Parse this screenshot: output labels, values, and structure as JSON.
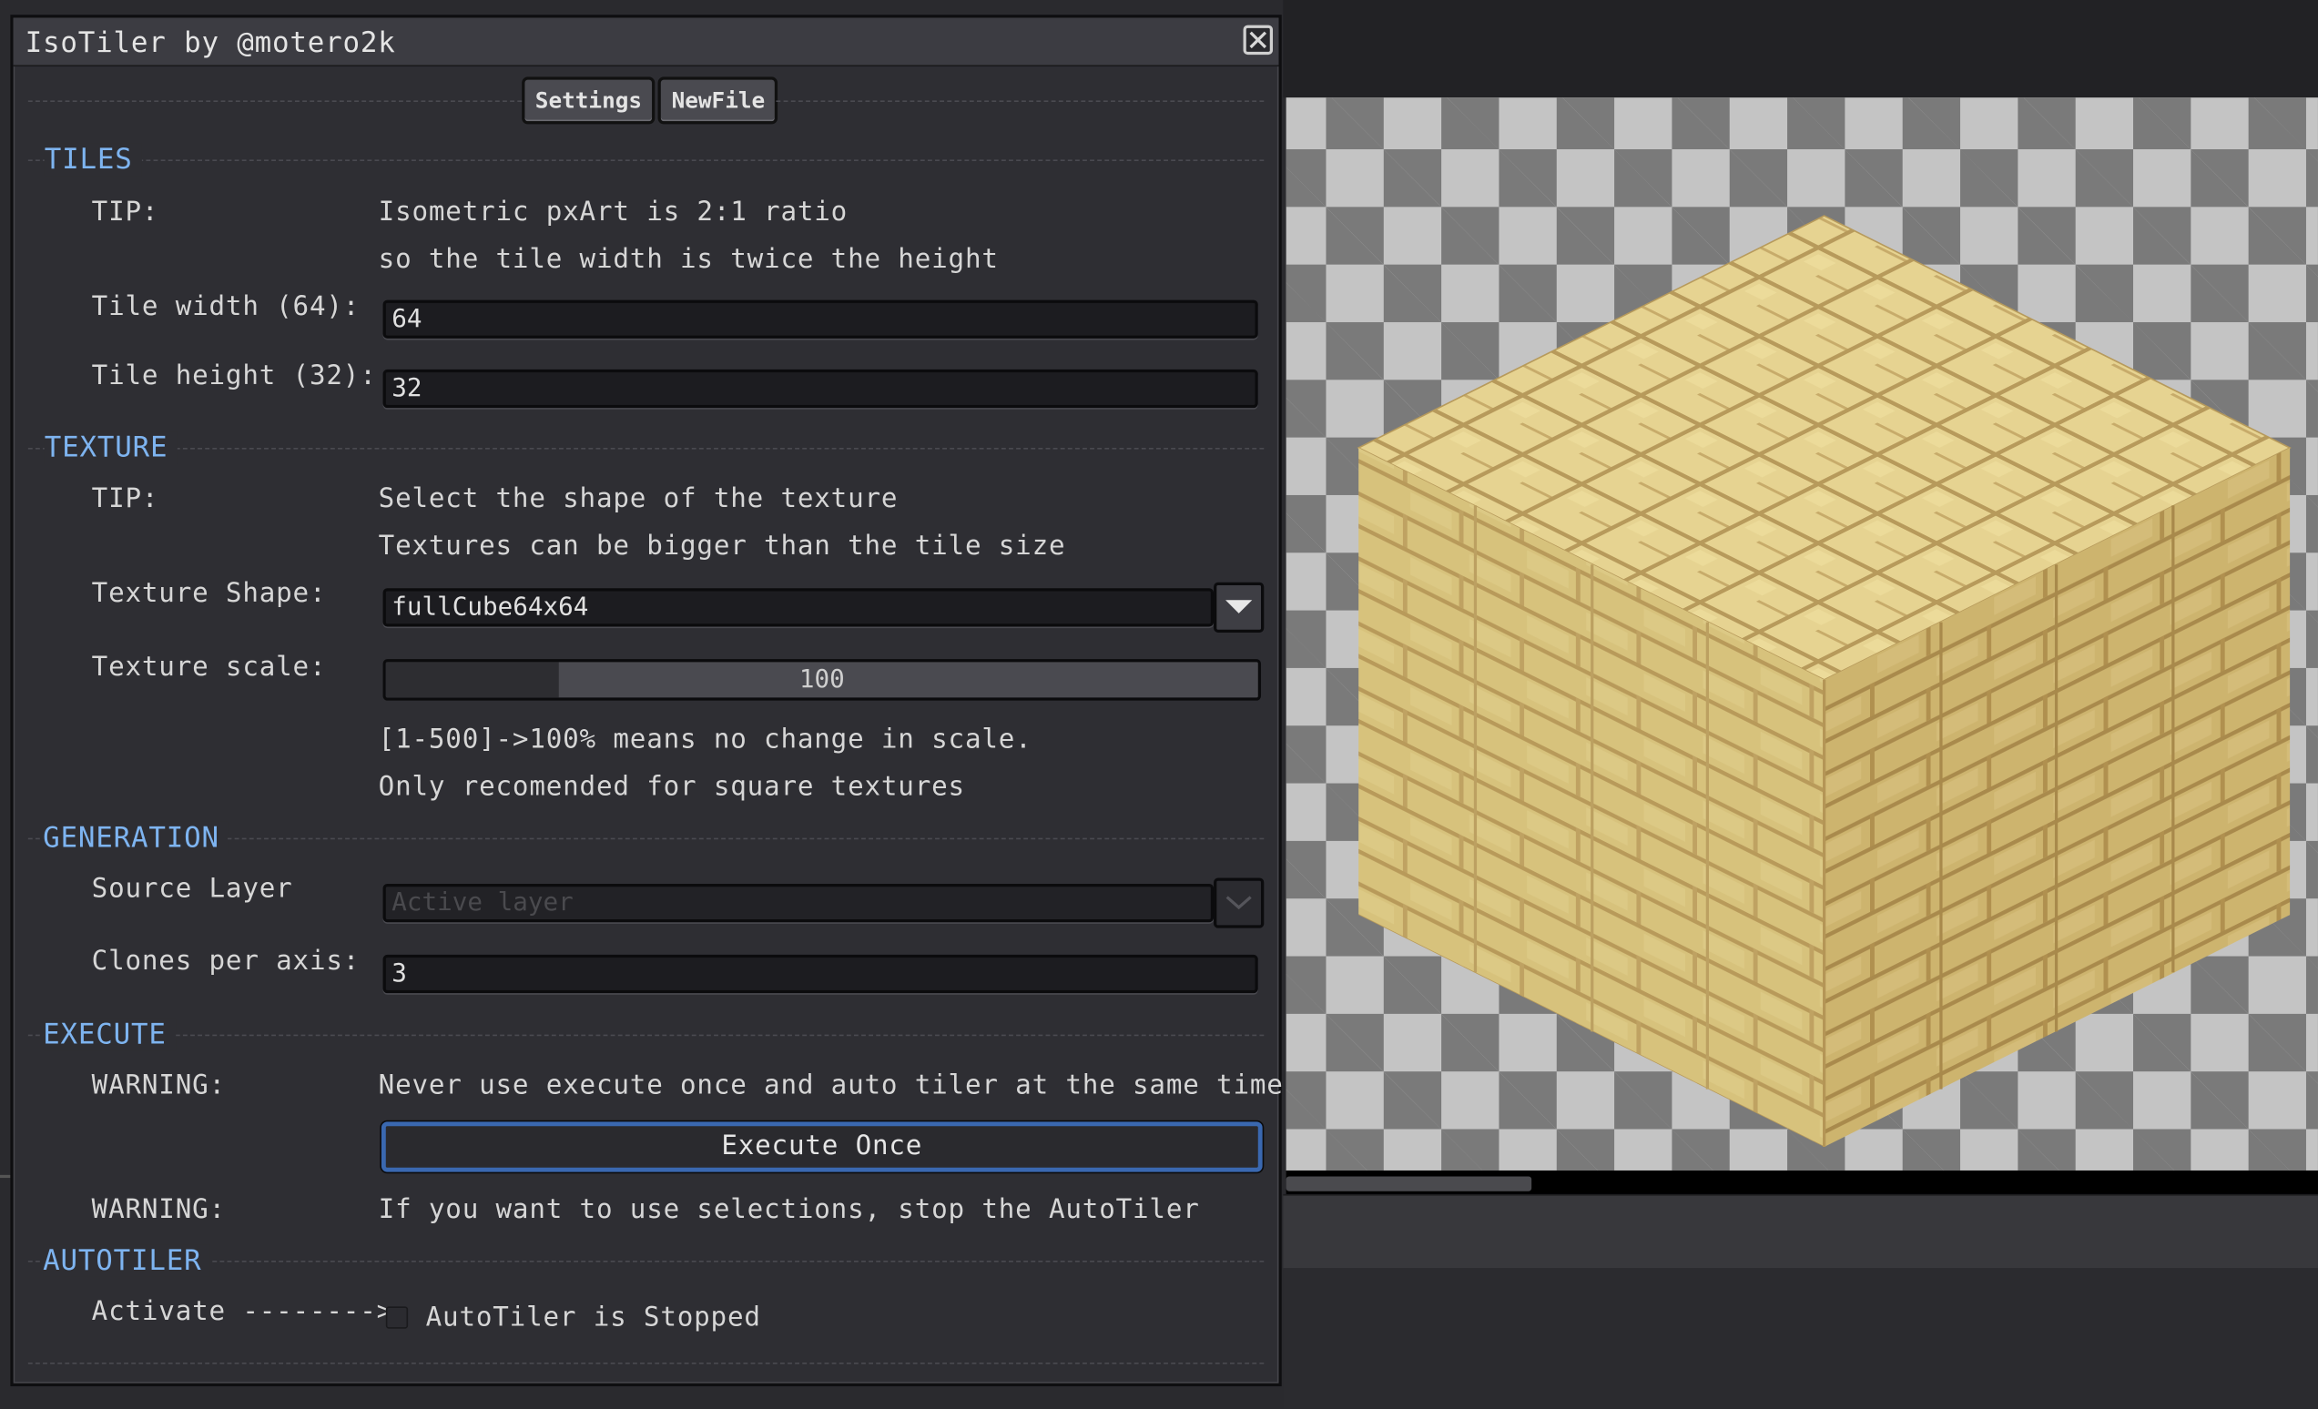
{
  "dialog": {
    "title": "IsoTiler by @motero2k",
    "tabs": [
      "Settings",
      "NewFile"
    ]
  },
  "tiles": {
    "section": "TILES",
    "tip_label": "TIP:",
    "tip_line1": "Isometric pxArt is 2:1 ratio",
    "tip_line2": "so the tile width is twice the height",
    "width_label": "Tile width (64):",
    "width_value": "64",
    "height_label": "Tile height (32):",
    "height_value": "32"
  },
  "texture": {
    "section": "TEXTURE",
    "tip_label": "TIP:",
    "tip_line1": "Select the shape of the texture",
    "tip_line2": "Textures can be bigger than the tile size",
    "shape_label": "Texture Shape:",
    "shape_value": "fullCube64x64",
    "scale_label": "Texture scale:",
    "scale_value": "100",
    "scale_min": 1,
    "scale_max": 500,
    "scale_note1": "[1-500]->100% means no change in scale.",
    "scale_note2": "Only recomended for square textures"
  },
  "generation": {
    "section": "GENERATION",
    "source_label": "Source Layer",
    "source_value": "Active layer",
    "clones_label": "Clones per axis:",
    "clones_value": "3"
  },
  "execute": {
    "section": "EXECUTE",
    "warning_label": "WARNING:",
    "warning_text": "Never use execute once and auto tiler at the same time",
    "button": "Execute Once",
    "warning2_label": "WARNING:",
    "warning2_text": "If you want to use selections, stop the AutoTiler"
  },
  "autotiler": {
    "section": "AUTOTILER",
    "activate_label": "Activate -------->",
    "checkbox_label": "AutoTiler is Stopped",
    "checked": false
  },
  "colors": {
    "section_header": "#7eb4f0",
    "accent_button_border": "#3a68b0",
    "panel_bg": "#2e2e33",
    "sandstone_top": "#e3cf8c",
    "sandstone_left": "#d4bf78",
    "sandstone_right": "#c9b06a",
    "mortar": "#a88a4c"
  },
  "icons": [
    "close-icon",
    "chevron-down-icon",
    "checkbox-icon"
  ]
}
